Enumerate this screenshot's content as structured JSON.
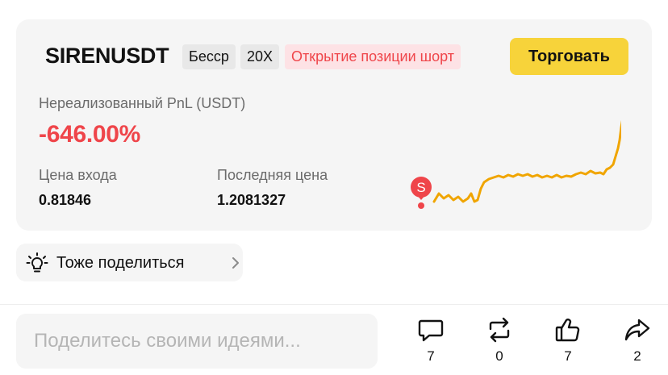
{
  "position": {
    "symbol": "SIRENUSDT",
    "margin_tag": "Бесср",
    "leverage_tag": "20X",
    "side_tag": "Открытие позиции шорт",
    "trade_button": "Торговать",
    "pnl_label": "Нереализованный PnL (USDT)",
    "pnl_value": "-646.00%",
    "entry_label": "Цена входа",
    "entry_value": "0.81846",
    "last_label": "Последняя цена",
    "last_value": "1.2081327",
    "marker_letter": "S"
  },
  "colors": {
    "accent_yellow": "#f7d33a",
    "loss_red": "#ef454a",
    "price_line": "#f0a500"
  },
  "share": {
    "label": "Тоже поделиться",
    "icon": "lightbulb-icon"
  },
  "composer": {
    "placeholder": "Поделитесь своими идеями..."
  },
  "actions": [
    {
      "name": "comment",
      "icon": "comment-icon",
      "count": "7"
    },
    {
      "name": "repost",
      "icon": "repost-icon",
      "count": "0"
    },
    {
      "name": "like",
      "icon": "thumbs-up-icon",
      "count": "7"
    },
    {
      "name": "share",
      "icon": "share-arrow-icon",
      "count": "2"
    }
  ]
}
